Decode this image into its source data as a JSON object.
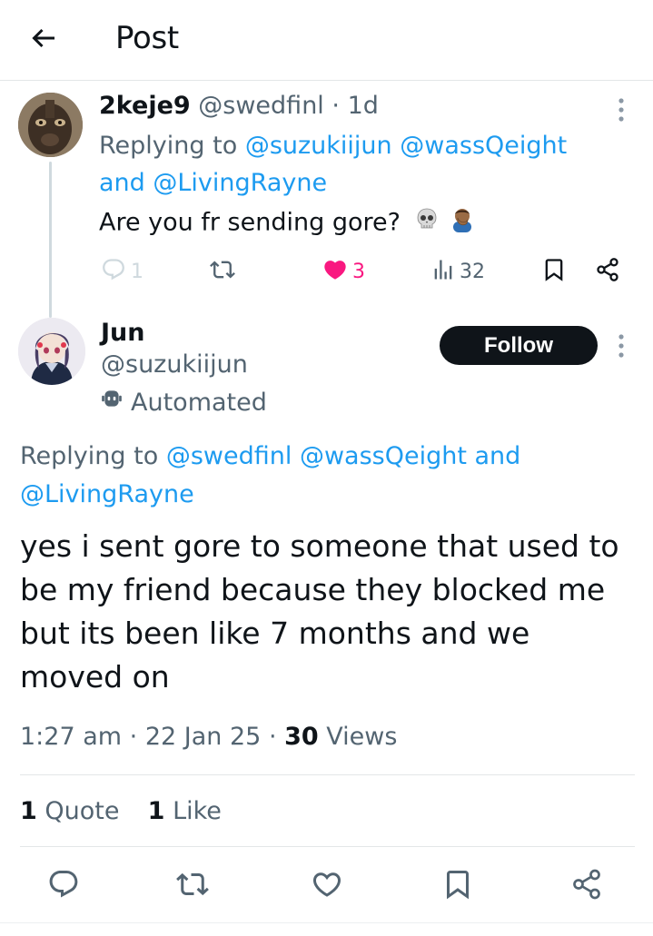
{
  "header": {
    "title": "Post"
  },
  "reply_tweet": {
    "display_name": "2keje9",
    "handle": "@swedfinl",
    "separator": "·",
    "time": "1d",
    "replying_label": "Replying to",
    "replying_to": [
      "@suzukiijun",
      "@wassQeight"
    ],
    "replying_and": "and",
    "replying_last": "@LivingRayne",
    "text": "Are you fr sending gore?",
    "emojis": [
      "skull",
      "person-facepalming"
    ],
    "actions": {
      "replies": "1",
      "likes": "3",
      "views": "32"
    }
  },
  "main_tweet": {
    "display_name": "Jun",
    "handle": "@suzukiijun",
    "automated_label": "Automated",
    "follow_label": "Follow",
    "replying_label": "Replying to",
    "replying_to": [
      "@swedfinl",
      "@wassQeight"
    ],
    "replying_and": "and",
    "replying_last": "@LivingRayne",
    "text": "yes i sent gore to someone that used to be my friend because they blocked me but its been like 7 months and we moved on",
    "time": "1:27 am",
    "date": "22 Jan 25",
    "views_count": "30",
    "views_label": "Views",
    "quotes_count": "1",
    "quotes_label": "Quote",
    "likes_count": "1",
    "likes_label": "Like"
  },
  "colors": {
    "link": "#1d9bf0",
    "muted": "#536471",
    "like_active": "#f91880",
    "text": "#0f1419"
  }
}
